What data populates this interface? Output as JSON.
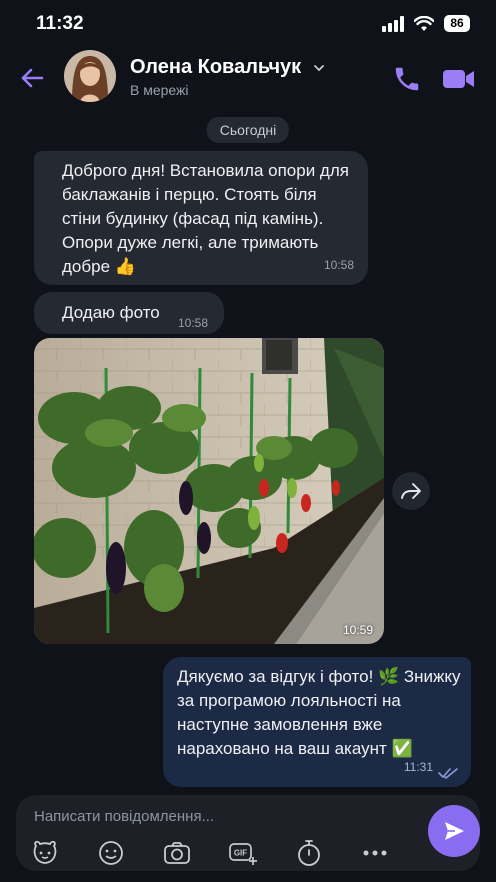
{
  "status": {
    "time": "11:32",
    "battery": "86"
  },
  "header": {
    "name": "Олена Ковальчук",
    "status": "В мережі"
  },
  "date_divider": "Сьогодні",
  "messages": [
    {
      "text": "Доброго дня! Встановила опори для баклажанів і перцю. Стоять біля стіни будинку (фасад під камінь). Опори дуже легкі, але тримають добре 👍",
      "time": "10:58"
    },
    {
      "text": "Додаю фото",
      "time": "10:58"
    },
    {
      "photo_time": "10:59"
    },
    {
      "text": "Дякуємо за відгук і фото! 🌿 Знижку за програмою лояльності на наступне замовлення вже нараховано на ваш акаунт ✅",
      "time": "11:31"
    }
  ],
  "composer": {
    "placeholder": "Написати повідомлення..."
  },
  "colors": {
    "accent": "#8a6cf0",
    "bubble_in": "#252932",
    "bubble_out": "#1d2a46",
    "background": "#0f1218"
  },
  "icons": [
    "back-arrow-icon",
    "chevron-down-icon",
    "phone-icon",
    "video-icon",
    "forward-icon",
    "sticker-icon",
    "emoji-icon",
    "camera-icon",
    "gif-icon",
    "timer-icon",
    "more-icon",
    "send-icon"
  ]
}
